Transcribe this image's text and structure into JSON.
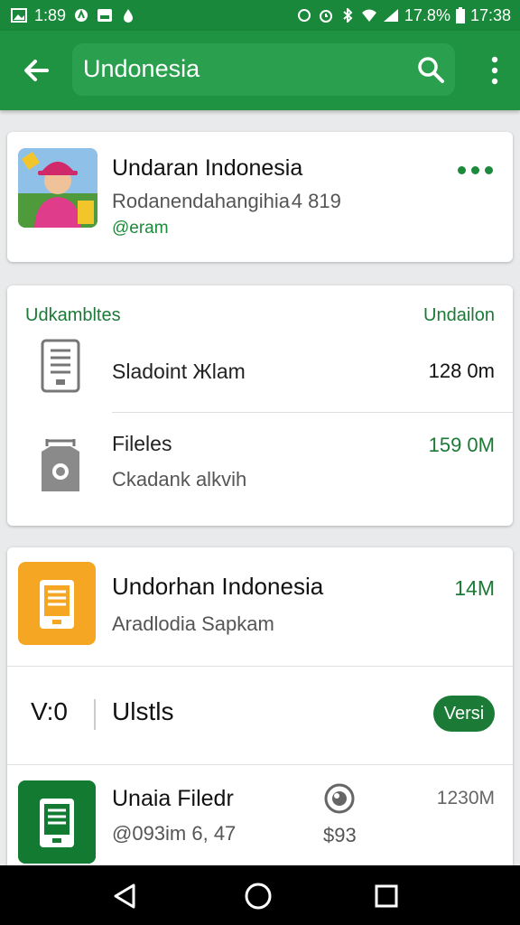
{
  "status_bar": {
    "time_left": "1:89",
    "battery": "17.8%",
    "time_right": "17:38"
  },
  "search": {
    "query": "Undonesia"
  },
  "profile": {
    "title": "Undaran Indonesia",
    "subtitle": "Rodanendahangihia 4 819",
    "handle": "@eram"
  },
  "storage": {
    "header_left": "Udkambltes",
    "header_right": "Undailon",
    "rows": [
      {
        "title": "Sladoint Жlam",
        "sub": "",
        "size": "128 0m",
        "size_color": "#111111"
      },
      {
        "title": "Fileles",
        "sub": "Ckadank alkvih",
        "size": "159 0M",
        "size_color": "#1c7a37"
      }
    ]
  },
  "app": {
    "title": "Undorhan Indonesia",
    "subtitle": "Aradlodia Sapkam",
    "size": "14M",
    "version_label": "V:0",
    "version_name": "Ulstls",
    "badge": "Versi"
  },
  "file": {
    "title": "Unaia Filedr",
    "subtitle": "@093im 6, 47",
    "price": "$93",
    "size": "1230M"
  },
  "colors": {
    "primary": "#1f9342",
    "accent": "#1c7a37",
    "app_icon": "#f5a623"
  },
  "icons": [
    "back-arrow-icon",
    "search-icon",
    "more-vert-icon",
    "document-icon",
    "camera-icon",
    "eye-icon"
  ]
}
